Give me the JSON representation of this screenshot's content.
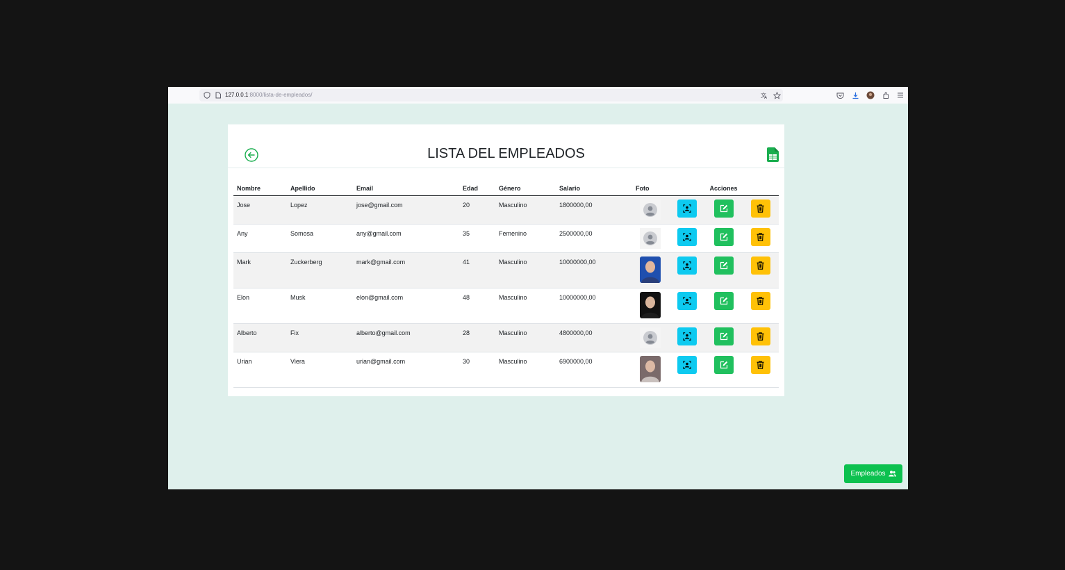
{
  "browser": {
    "url_host": "127.0.0.1",
    "url_rest": ":8000/lista-de-empleados/"
  },
  "page": {
    "title": "LISTA DEL EMPLEADOS",
    "columns": [
      "Nombre",
      "Apellido",
      "Email",
      "Edad",
      "Género",
      "Salario",
      "Foto",
      "Acciones"
    ],
    "employees": [
      {
        "nombre": "Jose",
        "apellido": "Lopez",
        "email": "jose@gmail.com",
        "edad": "20",
        "genero": "Masculino",
        "salario": "1800000,00",
        "foto": "default"
      },
      {
        "nombre": "Any",
        "apellido": "Somosa",
        "email": "any@gmail.com",
        "edad": "35",
        "genero": "Femenino",
        "salario": "2500000,00",
        "foto": "default"
      },
      {
        "nombre": "Mark",
        "apellido": "Zuckerberg",
        "email": "mark@gmail.com",
        "edad": "41",
        "genero": "Masculino",
        "salario": "10000000,00",
        "foto": "photo"
      },
      {
        "nombre": "Elon",
        "apellido": "Musk",
        "email": "elon@gmail.com",
        "edad": "48",
        "genero": "Masculino",
        "salario": "10000000,00",
        "foto": "photo"
      },
      {
        "nombre": "Alberto",
        "apellido": "Fix",
        "email": "alberto@gmail.com",
        "edad": "28",
        "genero": "Masculino",
        "salario": "4800000,00",
        "foto": "default"
      },
      {
        "nombre": "Urian",
        "apellido": "Viera",
        "email": "urian@gmail.com",
        "edad": "30",
        "genero": "Masculino",
        "salario": "6900000,00",
        "foto": "photo"
      }
    ],
    "footer_button": "Empleados"
  },
  "colors": {
    "page_bg": "#dff0ec",
    "view": "#0dcaf0",
    "edit": "#20c05e",
    "delete": "#ffc107",
    "accent_green": "#0cc14f"
  },
  "icons": [
    "shield-icon",
    "page-icon",
    "translate-icon",
    "star-icon",
    "pocket-icon",
    "download-icon",
    "profile-icon",
    "extensions-icon",
    "menu-icon",
    "back-arrow-icon",
    "spreadsheet-icon",
    "person-view-icon",
    "edit-icon",
    "trash-icon",
    "users-icon"
  ]
}
